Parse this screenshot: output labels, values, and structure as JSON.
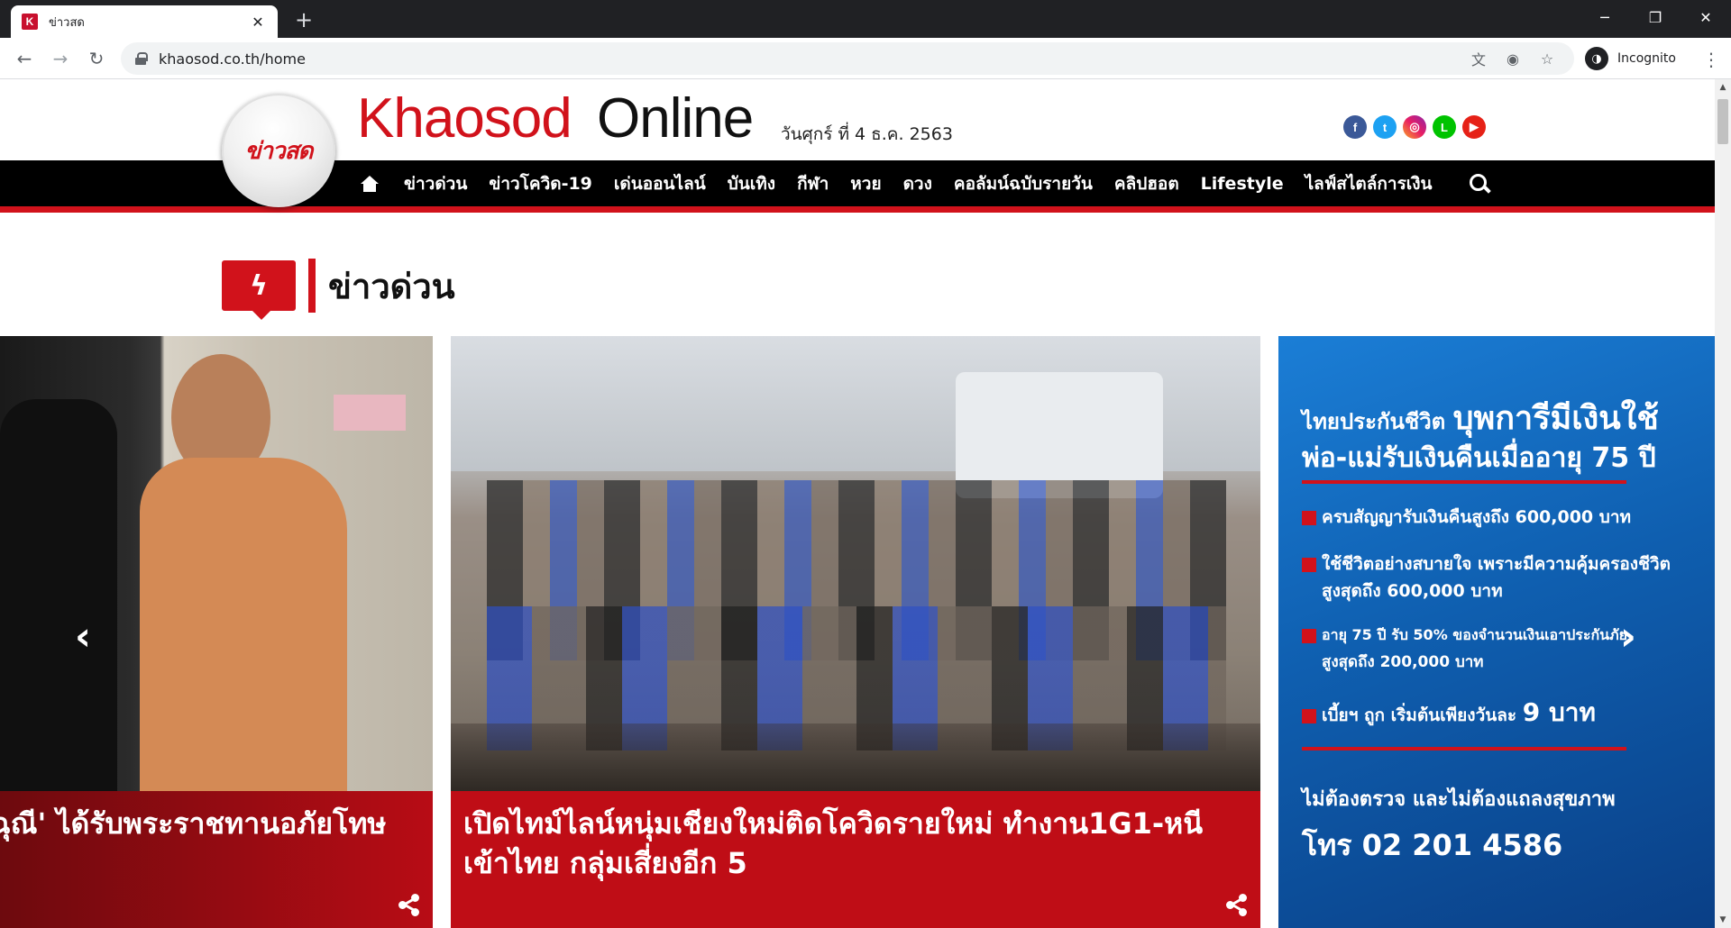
{
  "browser": {
    "tab_title": "ข่าวสด",
    "tab_favicon_letter": "K",
    "url": "khaosod.co.th/home",
    "incognito_label": "Incognito"
  },
  "header": {
    "logo_text": "ข่าวสด",
    "brand_red": "Khaosod",
    "brand_black": "Online",
    "date": "วันศุกร์ ที่ 4 ธ.ค. 2563",
    "social": [
      "facebook-icon",
      "twitter-icon",
      "instagram-icon",
      "line-icon",
      "youtube-icon"
    ]
  },
  "nav": {
    "items": [
      "ข่าวด่วน",
      "ข่าวโควิด-19",
      "เด่นออนไลน์",
      "บันเทิง",
      "กีฬา",
      "หวย",
      "ดวง",
      "คอลัมน์ฉบับรายวัน",
      "คลิปฮอต",
      "Lifestyle",
      "ไลฟ์สไตล์การเงิน"
    ]
  },
  "section": {
    "title": "ข่าวด่วน"
  },
  "carousel": {
    "left_caption": "ฉุณี' ได้รับพระราชทานอภัยโทษ",
    "center_caption": "เปิดไทม์ไลน์หนุ่มเชียงใหม่ติดโควิดรายใหม่ ทำงาน1G1-หนีเข้าไทย กลุ่มเสี่ยงอีก 5"
  },
  "ad": {
    "line1_a": "ไทยประกันชีวิต",
    "line1_b": "บุพการีมีเงินใช้",
    "line2": "พ่อ-แม่รับเงินคืนเมื่ออายุ 75 ปี",
    "bullet1": "ครบสัญญารับเงินคืนสูงถึง 600,000 บาท",
    "bullet2a": "ใช้ชีวิตอย่างสบายใจ เพราะมีความคุ้มครองชีวิต",
    "bullet2b": "สูงสุดถึง 600,000 บาท",
    "bullet3a": "อายุ 75 ปี รับ 50% ของจำนวนเงินเอาประกันภัย",
    "bullet3b": "สูงสุดถึง 200,000 บาท",
    "bullet4a": "เบี้ยฯ ถูก เริ่มต้นเพียงวันละ",
    "bullet4b": "9 บาท",
    "footer1": "ไม่ต้องตรวจ และไม่ต้องแถลงสุขภาพ",
    "footer2": "โทร 02 201 4586"
  }
}
